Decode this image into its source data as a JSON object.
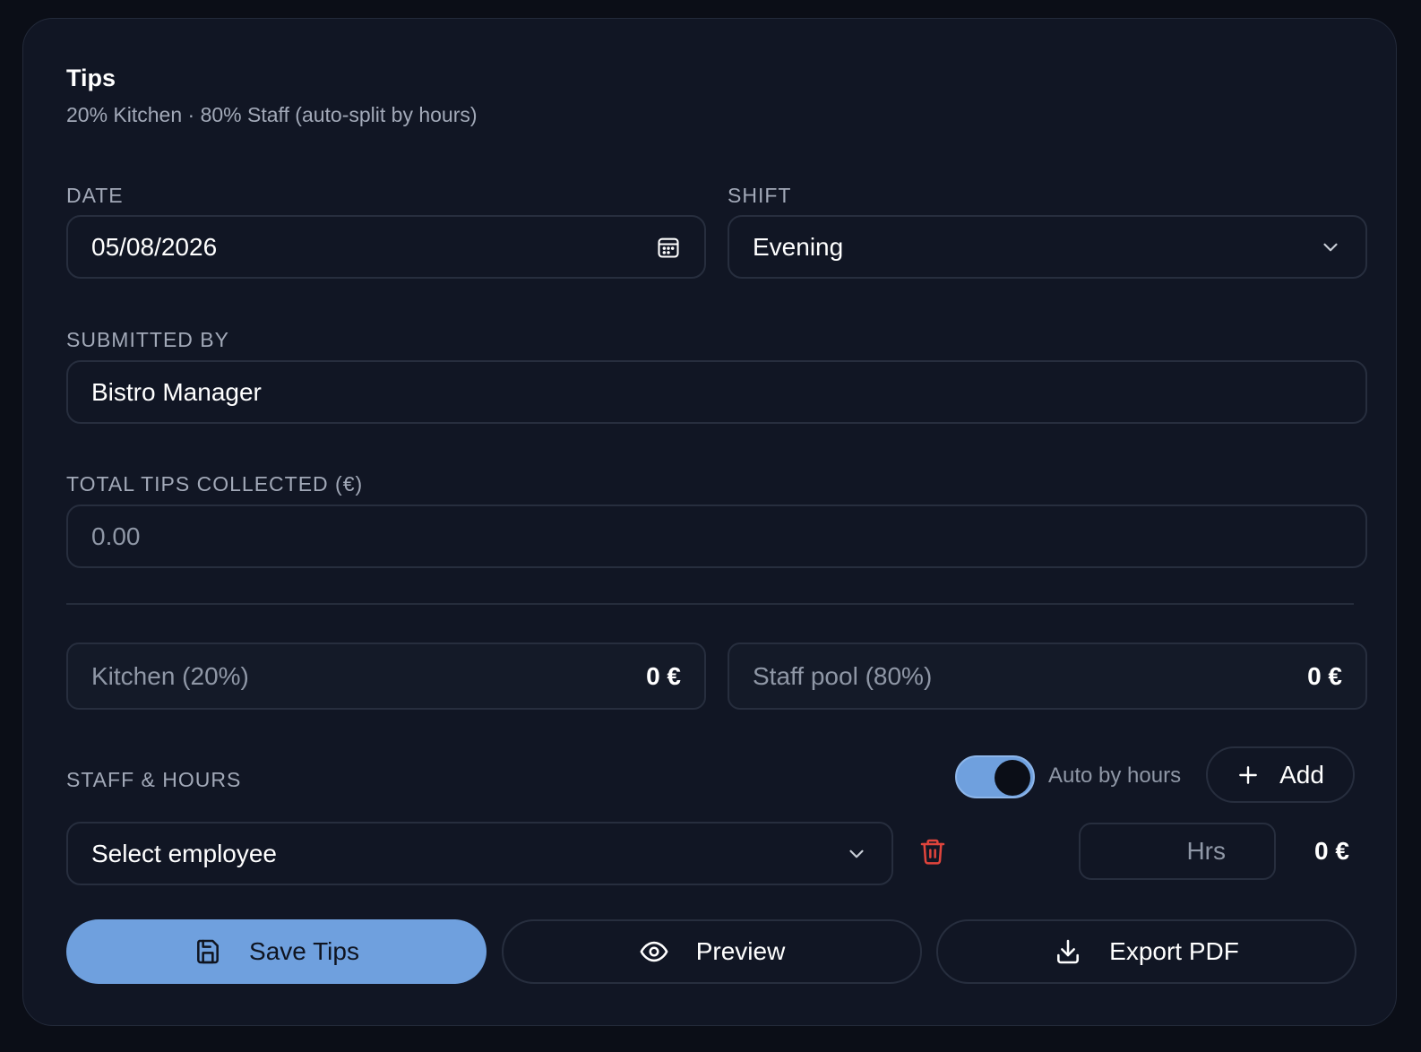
{
  "card": {
    "title": "Tips",
    "subtitle": "20% Kitchen · 80% Staff (auto-split by hours)"
  },
  "date": {
    "label": "DATE",
    "value": "05/08/2026",
    "icon": "calendar-icon"
  },
  "shift": {
    "label": "SHIFT",
    "value": "Evening",
    "icon": "chevron-down-icon"
  },
  "submitted_by": {
    "label": "SUBMITTED BY",
    "value": "Bistro Manager"
  },
  "total_tips": {
    "label": "TOTAL TIPS COLLECTED (€)",
    "placeholder": "0.00"
  },
  "split": {
    "kitchen_label": "Kitchen (20%)",
    "kitchen_amount": "0 €",
    "staff_label": "Staff pool (80%)",
    "staff_amount": "0 €"
  },
  "staff_hours": {
    "label": "STAFF & HOURS",
    "auto_toggle_label": "Auto by hours",
    "auto_toggle_on": true,
    "add_label": "Add",
    "rows": [
      {
        "employee_placeholder": "Select employee",
        "hours_placeholder": "Hrs",
        "amount": "0 €"
      }
    ]
  },
  "actions": {
    "save_label": "Save Tips",
    "preview_label": "Preview",
    "export_label": "Export PDF"
  },
  "colors": {
    "accent": "#6fa0de",
    "danger": "#e0443c",
    "background": "#111624"
  }
}
